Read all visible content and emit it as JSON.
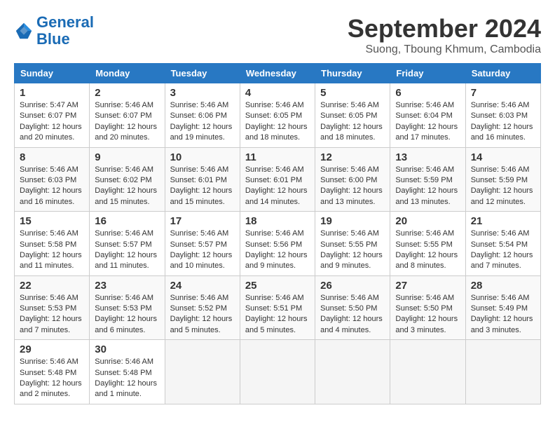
{
  "header": {
    "logo_line1": "General",
    "logo_line2": "Blue",
    "month_title": "September 2024",
    "location": "Suong, Tboung Khmum, Cambodia"
  },
  "weekdays": [
    "Sunday",
    "Monday",
    "Tuesday",
    "Wednesday",
    "Thursday",
    "Friday",
    "Saturday"
  ],
  "weeks": [
    [
      {
        "day": "1",
        "info": "Sunrise: 5:47 AM\nSunset: 6:07 PM\nDaylight: 12 hours and 20 minutes."
      },
      {
        "day": "2",
        "info": "Sunrise: 5:46 AM\nSunset: 6:07 PM\nDaylight: 12 hours and 20 minutes."
      },
      {
        "day": "3",
        "info": "Sunrise: 5:46 AM\nSunset: 6:06 PM\nDaylight: 12 hours and 19 minutes."
      },
      {
        "day": "4",
        "info": "Sunrise: 5:46 AM\nSunset: 6:05 PM\nDaylight: 12 hours and 18 minutes."
      },
      {
        "day": "5",
        "info": "Sunrise: 5:46 AM\nSunset: 6:05 PM\nDaylight: 12 hours and 18 minutes."
      },
      {
        "day": "6",
        "info": "Sunrise: 5:46 AM\nSunset: 6:04 PM\nDaylight: 12 hours and 17 minutes."
      },
      {
        "day": "7",
        "info": "Sunrise: 5:46 AM\nSunset: 6:03 PM\nDaylight: 12 hours and 16 minutes."
      }
    ],
    [
      {
        "day": "8",
        "info": "Sunrise: 5:46 AM\nSunset: 6:03 PM\nDaylight: 12 hours and 16 minutes."
      },
      {
        "day": "9",
        "info": "Sunrise: 5:46 AM\nSunset: 6:02 PM\nDaylight: 12 hours and 15 minutes."
      },
      {
        "day": "10",
        "info": "Sunrise: 5:46 AM\nSunset: 6:01 PM\nDaylight: 12 hours and 15 minutes."
      },
      {
        "day": "11",
        "info": "Sunrise: 5:46 AM\nSunset: 6:01 PM\nDaylight: 12 hours and 14 minutes."
      },
      {
        "day": "12",
        "info": "Sunrise: 5:46 AM\nSunset: 6:00 PM\nDaylight: 12 hours and 13 minutes."
      },
      {
        "day": "13",
        "info": "Sunrise: 5:46 AM\nSunset: 5:59 PM\nDaylight: 12 hours and 13 minutes."
      },
      {
        "day": "14",
        "info": "Sunrise: 5:46 AM\nSunset: 5:59 PM\nDaylight: 12 hours and 12 minutes."
      }
    ],
    [
      {
        "day": "15",
        "info": "Sunrise: 5:46 AM\nSunset: 5:58 PM\nDaylight: 12 hours and 11 minutes."
      },
      {
        "day": "16",
        "info": "Sunrise: 5:46 AM\nSunset: 5:57 PM\nDaylight: 12 hours and 11 minutes."
      },
      {
        "day": "17",
        "info": "Sunrise: 5:46 AM\nSunset: 5:57 PM\nDaylight: 12 hours and 10 minutes."
      },
      {
        "day": "18",
        "info": "Sunrise: 5:46 AM\nSunset: 5:56 PM\nDaylight: 12 hours and 9 minutes."
      },
      {
        "day": "19",
        "info": "Sunrise: 5:46 AM\nSunset: 5:55 PM\nDaylight: 12 hours and 9 minutes."
      },
      {
        "day": "20",
        "info": "Sunrise: 5:46 AM\nSunset: 5:55 PM\nDaylight: 12 hours and 8 minutes."
      },
      {
        "day": "21",
        "info": "Sunrise: 5:46 AM\nSunset: 5:54 PM\nDaylight: 12 hours and 7 minutes."
      }
    ],
    [
      {
        "day": "22",
        "info": "Sunrise: 5:46 AM\nSunset: 5:53 PM\nDaylight: 12 hours and 7 minutes."
      },
      {
        "day": "23",
        "info": "Sunrise: 5:46 AM\nSunset: 5:53 PM\nDaylight: 12 hours and 6 minutes."
      },
      {
        "day": "24",
        "info": "Sunrise: 5:46 AM\nSunset: 5:52 PM\nDaylight: 12 hours and 5 minutes."
      },
      {
        "day": "25",
        "info": "Sunrise: 5:46 AM\nSunset: 5:51 PM\nDaylight: 12 hours and 5 minutes."
      },
      {
        "day": "26",
        "info": "Sunrise: 5:46 AM\nSunset: 5:50 PM\nDaylight: 12 hours and 4 minutes."
      },
      {
        "day": "27",
        "info": "Sunrise: 5:46 AM\nSunset: 5:50 PM\nDaylight: 12 hours and 3 minutes."
      },
      {
        "day": "28",
        "info": "Sunrise: 5:46 AM\nSunset: 5:49 PM\nDaylight: 12 hours and 3 minutes."
      }
    ],
    [
      {
        "day": "29",
        "info": "Sunrise: 5:46 AM\nSunset: 5:48 PM\nDaylight: 12 hours and 2 minutes."
      },
      {
        "day": "30",
        "info": "Sunrise: 5:46 AM\nSunset: 5:48 PM\nDaylight: 12 hours and 1 minute."
      },
      {
        "day": "",
        "info": ""
      },
      {
        "day": "",
        "info": ""
      },
      {
        "day": "",
        "info": ""
      },
      {
        "day": "",
        "info": ""
      },
      {
        "day": "",
        "info": ""
      }
    ]
  ]
}
